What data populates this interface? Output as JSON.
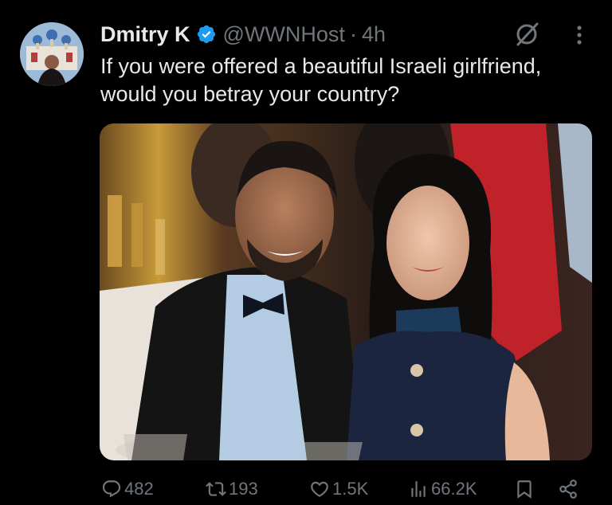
{
  "post": {
    "author_name": "Dmitry K",
    "handle": "@WWNHost",
    "separator": "·",
    "time": "4h",
    "text": "If you were offered a beautiful Israeli girlfriend, would you betray your country?"
  },
  "icons": {
    "verified": "verified-badge-icon",
    "grok": "grok-icon",
    "more": "more-icon",
    "reply": "reply-icon",
    "repost": "repost-icon",
    "like": "like-icon",
    "views": "views-icon",
    "bookmark": "bookmark-icon",
    "share": "share-icon"
  },
  "stats": {
    "replies": "482",
    "reposts": "193",
    "likes": "1.5K",
    "views": "66.2K"
  },
  "colors": {
    "background": "#000000",
    "text": "#e7e9ea",
    "secondary": "#71767b",
    "verified": "#1d9bf0"
  }
}
